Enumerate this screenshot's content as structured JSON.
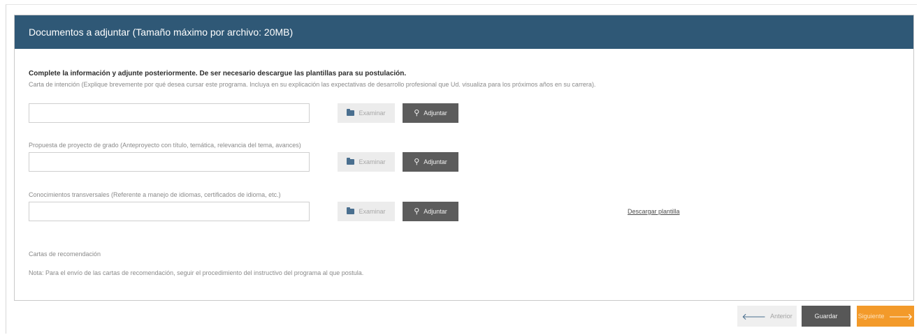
{
  "panel": {
    "title": "Documentos a adjuntar (Tamaño máximo por archivo: 20MB)",
    "instructions": "Complete la información y adjunte posteriormente. De ser necesario descargue las plantillas para su postulación."
  },
  "fields": [
    {
      "label": "Carta de intención (Explique brevemente por qué desea cursar este programa. Incluya en su explicación las expectativas de desarrollo profesional que Ud. visualiza para los próximos años en su carrera).",
      "value": "",
      "browse_label": "Examinar",
      "attach_label": "Adjuntar"
    },
    {
      "label": "Propuesta de proyecto de grado (Anteproyecto con título, temática, relevancia del tema, avances)",
      "value": "",
      "browse_label": "Examinar",
      "attach_label": "Adjuntar"
    },
    {
      "label": "Conocimientos transversales (Referente a manejo de idiomas, certificados de idioma, etc.)",
      "value": "",
      "browse_label": "Examinar",
      "attach_label": "Adjuntar"
    }
  ],
  "download_template": "Descargar plantilla",
  "recommendation": {
    "title": "Cartas de recomendación",
    "note": "Nota: Para el envío de las cartas de recomendación, seguir el procedimiento del instructivo del programa al que postula."
  },
  "footer": {
    "previous_label": "Anterior",
    "save_label": "Guardar",
    "next_label": "Siguiente"
  },
  "icons": {
    "browse": "folder-icon",
    "attach": "paperclip-icon",
    "previous": "arrow-left-icon",
    "next": "arrow-right-icon"
  },
  "colors": {
    "header_bg": "#2f5876",
    "attach_button_bg": "#5c5c5c",
    "save_button_bg": "#575757",
    "next_button_bg": "#f39a2a"
  }
}
